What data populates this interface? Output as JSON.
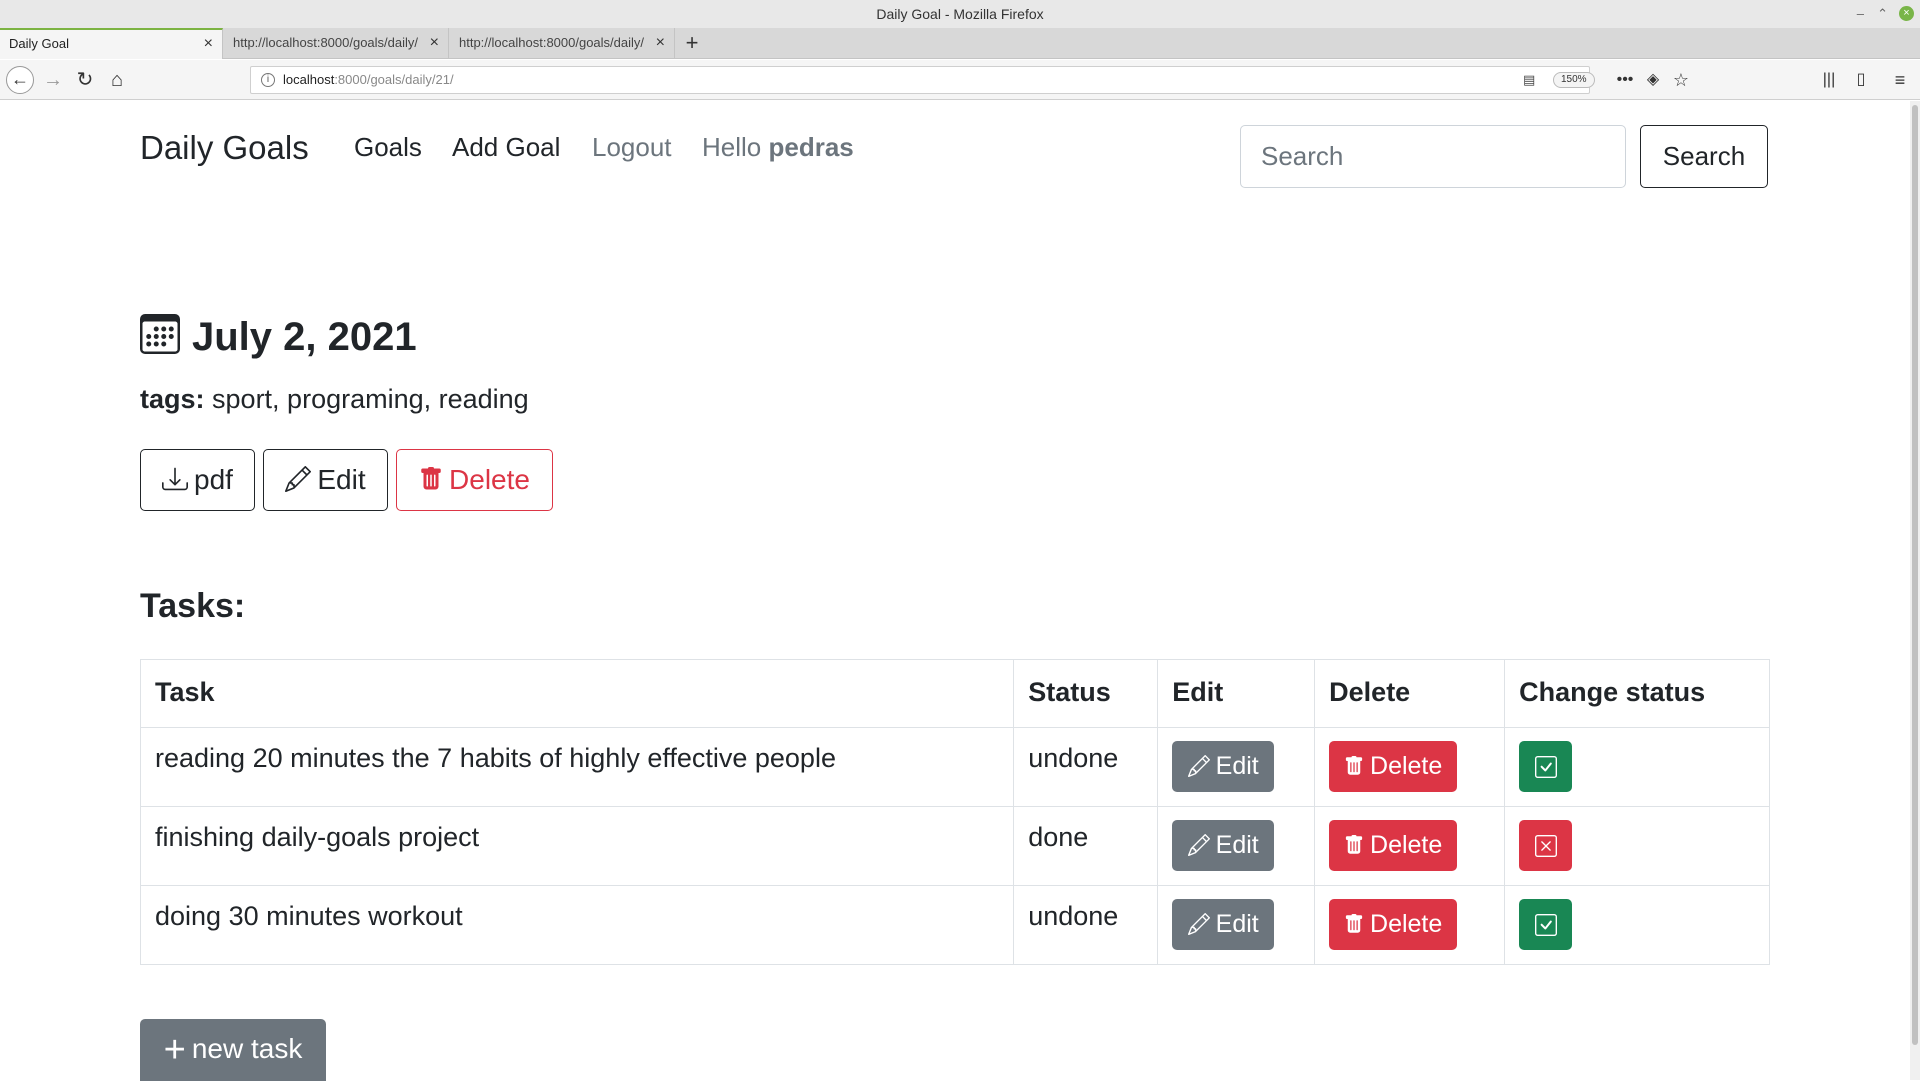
{
  "browser": {
    "window_title": "Daily Goal - Mozilla Firefox",
    "tabs": [
      {
        "label": "Daily Goal"
      },
      {
        "label": "http://localhost:8000/goals/daily/"
      },
      {
        "label": "http://localhost:8000/goals/daily/"
      }
    ],
    "url_host": "localhost",
    "url_path": ":8000/goals/daily/21/",
    "zoom": "150%"
  },
  "site": {
    "brand": "Daily Goals",
    "nav": {
      "goals": "Goals",
      "add_goal": "Add Goal",
      "logout": "Logout",
      "hello": "Hello",
      "username": "pedras"
    },
    "search": {
      "placeholder": "Search",
      "button": "Search"
    }
  },
  "goal": {
    "date": "July 2, 2021",
    "tags_label": "tags:",
    "tags": "sport, programing, reading",
    "actions": {
      "pdf": "pdf",
      "edit": "Edit",
      "delete": "Delete"
    }
  },
  "tasks": {
    "heading": "Tasks:",
    "columns": [
      "Task",
      "Status",
      "Edit",
      "Delete",
      "Change status"
    ],
    "edit_label": "Edit",
    "delete_label": "Delete",
    "rows": [
      {
        "task": "reading 20 minutes the 7 habits of highly effective people",
        "status": "undone"
      },
      {
        "task": "finishing daily-goals project",
        "status": "done"
      },
      {
        "task": "doing 30 minutes workout",
        "status": "undone"
      }
    ],
    "new_task": "new task"
  },
  "colors": {
    "secondary": "#6c757d",
    "danger": "#dc3545",
    "success": "#198754",
    "dark": "#212529"
  }
}
